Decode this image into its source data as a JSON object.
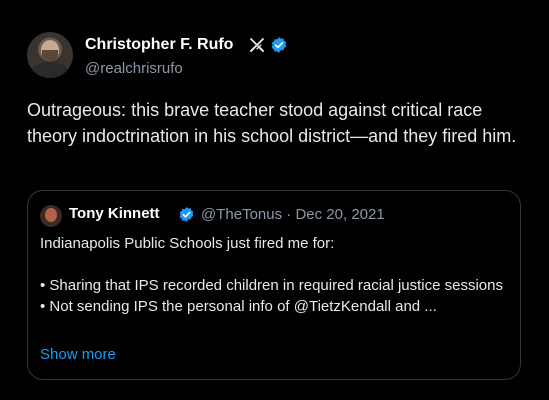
{
  "tweet": {
    "author_name": "Christopher F. Rufo",
    "author_handle": "@realchrisrufo",
    "author_badge_icon": "crossed-swords-icon",
    "verified_icon": "verified-badge-icon",
    "body": "Outrageous: this brave teacher stood against critical race theory indoctrination in his school district—and they fired him."
  },
  "quoted_tweet": {
    "author_name": "Tony Kinnett",
    "author_handle": "@TheTonus",
    "separator": "·",
    "date": "Dec 20, 2021",
    "lines": [
      "Indianapolis Public Schools just fired me for:",
      "• Sharing that IPS recorded children in required racial justice sessions",
      "• Not sending IPS the personal info of @TietzKendall and ..."
    ],
    "show_more": "Show more"
  },
  "colors": {
    "background": "#000000",
    "text": "#e7e9ea",
    "secondary": "#8b98a5",
    "link": "#1d9bf0",
    "verified": "#1d9bf0",
    "border": "#333639"
  }
}
